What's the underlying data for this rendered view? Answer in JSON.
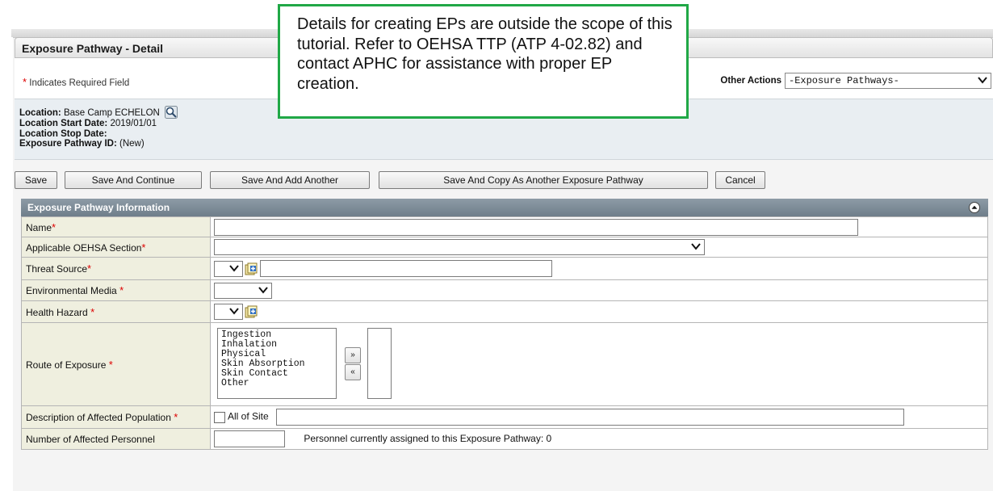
{
  "window": {
    "title": "Exposure Pathway - Detail"
  },
  "required_note": {
    "star": "*",
    "text": "Indicates Required Field"
  },
  "other_actions": {
    "label": "Other Actions",
    "selected": "-Exposure Pathways-"
  },
  "location": {
    "location_label": "Location:",
    "location_value": "Base Camp ECHELON",
    "start_label": "Location Start Date:",
    "start_value": "2019/01/01",
    "stop_label": "Location Stop Date:",
    "stop_value": "",
    "id_label": "Exposure Pathway ID:",
    "id_value": "(New)"
  },
  "buttons": {
    "save": "Save",
    "save_continue": "Save And Continue",
    "save_add": "Save And Add Another",
    "save_copy": "Save And Copy As Another Exposure Pathway",
    "cancel": "Cancel"
  },
  "panel": {
    "title": "Exposure Pathway Information"
  },
  "fields": {
    "name": {
      "label": "Name",
      "value": ""
    },
    "oehsa_section": {
      "label": "Applicable OEHSA Section",
      "value": ""
    },
    "threat_source": {
      "label": "Threat Source",
      "value": ""
    },
    "environmental_media": {
      "label": "Environmental Media",
      "value": ""
    },
    "health_hazard": {
      "label": "Health Hazard",
      "value": ""
    },
    "route_of_exposure": {
      "label": "Route of Exposure",
      "options": [
        "Ingestion",
        "Inhalation",
        "Physical",
        "Skin Absorption",
        "Skin Contact",
        "Other"
      ],
      "add_symbol": "»",
      "remove_symbol": "«"
    },
    "affected_population": {
      "label": "Description of Affected Population",
      "checkbox_label": "All of Site",
      "value": ""
    },
    "affected_personnel": {
      "label": "Number of Affected Personnel",
      "value": "",
      "note": "Personnel currently assigned to this Exposure Pathway: 0"
    }
  },
  "required_star": "*",
  "callout": {
    "text": "Details for creating EPs are outside the scope of this tutorial. Refer to OEHSA TTP (ATP 4-02.82) and contact APHC for assistance with proper EP creation."
  },
  "colors": {
    "panel_header": "#7d8b96",
    "label_cell": "#efefdf",
    "location_block": "#e9eef2",
    "required_star": "#dd0000",
    "callout_border": "#20a846"
  },
  "icons": {
    "lookup": "magnifier-icon",
    "add": "add-item-icon",
    "collapse": "collapse-up-icon",
    "dropdown": "chevron-down-icon"
  }
}
